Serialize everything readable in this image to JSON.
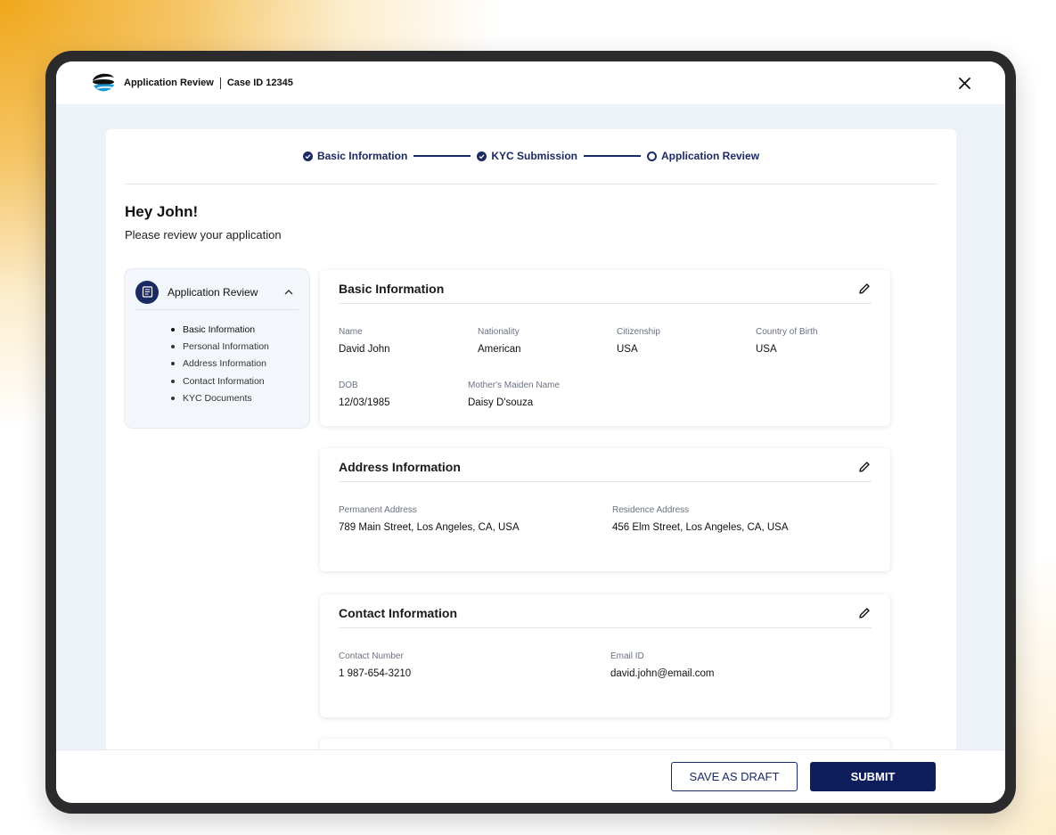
{
  "header": {
    "app_title": "Application Review",
    "case_id": "Case ID 12345"
  },
  "stepper": {
    "steps": [
      {
        "label": "Basic Information",
        "status": "complete"
      },
      {
        "label": "KYC Submission",
        "status": "complete"
      },
      {
        "label": "Application Review",
        "status": "current"
      }
    ]
  },
  "greeting": {
    "title": "Hey John!",
    "subtitle": "Please review your application"
  },
  "sidebar": {
    "title": "Application Review",
    "items": [
      {
        "label": "Basic Information"
      },
      {
        "label": "Personal Information"
      },
      {
        "label": "Address Information"
      },
      {
        "label": "Contact Information"
      },
      {
        "label": "KYC Documents"
      }
    ]
  },
  "sections": {
    "basic": {
      "title": "Basic Information",
      "fields": {
        "name": {
          "label": "Name",
          "value": "David John"
        },
        "nationality": {
          "label": "Nationality",
          "value": "American"
        },
        "citizenship": {
          "label": "Citizenship",
          "value": "USA"
        },
        "country_of_birth": {
          "label": "Country of Birth",
          "value": "USA"
        },
        "dob": {
          "label": "DOB",
          "value": "12/03/1985"
        },
        "maiden_name": {
          "label": "Mother's Maiden Name",
          "value": "Daisy D'souza"
        }
      }
    },
    "address": {
      "title": "Address Information",
      "fields": {
        "permanent": {
          "label": "Permanent Address",
          "value": "789 Main Street, Los Angeles, CA, USA"
        },
        "residence": {
          "label": "Residence Address",
          "value": "456 Elm Street, Los Angeles, CA, USA"
        }
      }
    },
    "contact": {
      "title": "Contact Information",
      "fields": {
        "phone": {
          "label": "Contact Number",
          "value": "1 987-654-3210"
        },
        "email": {
          "label": "Email ID",
          "value": "david.john@email.com"
        }
      }
    }
  },
  "footer": {
    "draft_label": "SAVE AS DRAFT",
    "submit_label": "SUBMIT"
  },
  "colors": {
    "primary": "#1c2a63",
    "submit_bg": "#0e1e5c",
    "accent_glow": "#f0a81c"
  }
}
